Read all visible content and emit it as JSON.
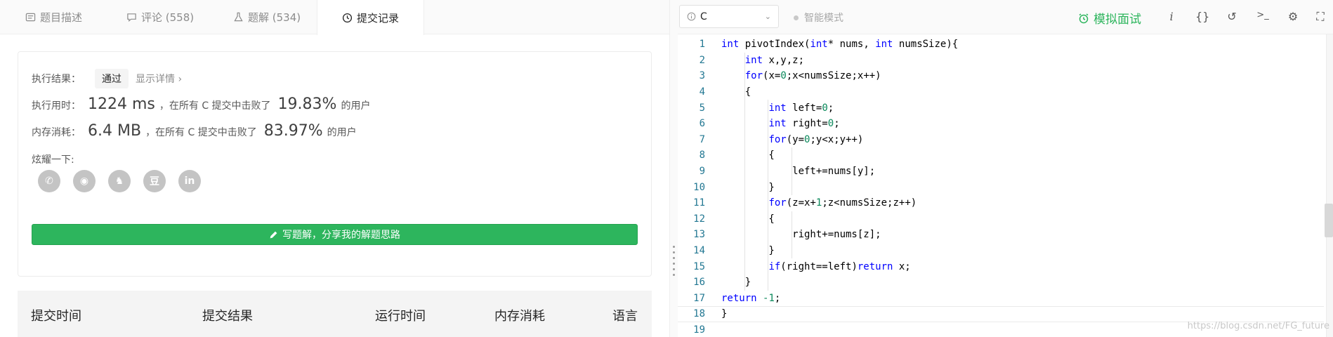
{
  "tabs": [
    {
      "label": "题目描述",
      "icon": "description-icon"
    },
    {
      "label": "评论 (558)",
      "icon": "comment-icon"
    },
    {
      "label": "题解 (534)",
      "icon": "flask-icon"
    },
    {
      "label": "提交记录",
      "icon": "clock-icon"
    }
  ],
  "result": {
    "label": "执行结果：",
    "status": "通过",
    "details": "显示详情 ›",
    "time_label": "执行用时：",
    "time_value": "1224 ms",
    "time_mid": "，在所有 C 提交中击败了",
    "time_pct": "19.83%",
    "time_suffix": "的用户",
    "mem_label": "内存消耗：",
    "mem_value": "6.4 MB",
    "mem_mid": "，在所有 C 提交中击败了",
    "mem_pct": "83.97%",
    "mem_suffix": "的用户",
    "share_label": "炫耀一下:",
    "share_icons": [
      "wechat-icon",
      "weibo-icon",
      "qq-icon",
      "douban-icon",
      "linkedin-icon"
    ],
    "share_glyphs": [
      "✆",
      "◉",
      "♞",
      "豆",
      "in"
    ],
    "write_button": "写题解，分享我的解题思路"
  },
  "table": {
    "headers": [
      "提交时间",
      "提交结果",
      "运行时间",
      "内存消耗",
      "语言"
    ]
  },
  "editor": {
    "language": "C",
    "smart_mode": "智能模式",
    "mock_interview": "模拟面试",
    "tool_icons": [
      "info-icon",
      "braces-icon",
      "reset-icon",
      "terminal-icon",
      "settings-icon",
      "fullscreen-icon"
    ],
    "tool_glyphs": [
      "i",
      "{}",
      "↺",
      ">_",
      "⚙",
      "⛶"
    ],
    "current_line": 18,
    "line_numbers": [
      "1",
      "2",
      "3",
      "4",
      "5",
      "6",
      "7",
      "8",
      "9",
      "10",
      "11",
      "12",
      "13",
      "14",
      "15",
      "16",
      "17",
      "18",
      "19"
    ],
    "code_lines": [
      "int pivotIndex(int* nums, int numsSize){",
      "    int x,y,z;",
      "    for(x=0;x<numsSize;x++)",
      "    {",
      "        int left=0;",
      "        int right=0;",
      "        for(y=0;y<x;y++)",
      "        {",
      "            left+=nums[y];",
      "        }",
      "        for(z=x+1;z<numsSize;z++)",
      "        {",
      "            right+=nums[z];",
      "        }",
      "        if(right==left)return x;",
      "    }",
      "return -1;",
      "}",
      ""
    ]
  },
  "watermark": "https://blog.csdn.net/FG_future",
  "colors": {
    "accent_green": "#2db55d",
    "keyword_blue": "#0000ff",
    "number_green": "#09885a",
    "line_number": "#237893"
  }
}
